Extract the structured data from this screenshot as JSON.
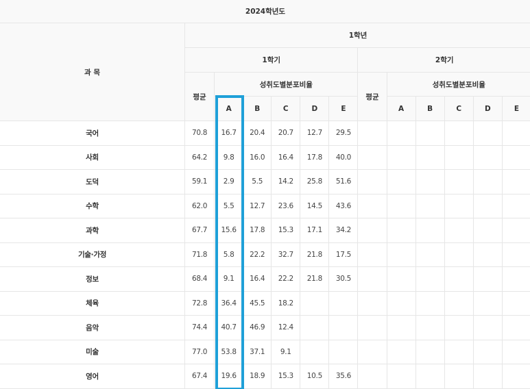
{
  "table": {
    "year": "2024학년도",
    "subject_header": "과 목",
    "grade": "1학년",
    "semesters": [
      {
        "label": "1학기",
        "avg_label": "평균",
        "dist_label": "성취도별분포비율"
      },
      {
        "label": "2학기",
        "avg_label": "평균",
        "dist_label": "성취도별분포비율"
      }
    ],
    "letters": [
      "A",
      "B",
      "C",
      "D",
      "E"
    ],
    "rows": [
      {
        "subject": "국어",
        "avg": "70.8",
        "a": "16.7",
        "b": "20.4",
        "c": "20.7",
        "d": "12.7",
        "e": "29.5"
      },
      {
        "subject": "사회",
        "avg": "64.2",
        "a": "9.8",
        "b": "16.0",
        "c": "16.4",
        "d": "17.8",
        "e": "40.0"
      },
      {
        "subject": "도덕",
        "avg": "59.1",
        "a": "2.9",
        "b": "5.5",
        "c": "14.2",
        "d": "25.8",
        "e": "51.6"
      },
      {
        "subject": "수학",
        "avg": "62.0",
        "a": "5.5",
        "b": "12.7",
        "c": "23.6",
        "d": "14.5",
        "e": "43.6"
      },
      {
        "subject": "과학",
        "avg": "67.7",
        "a": "15.6",
        "b": "17.8",
        "c": "15.3",
        "d": "17.1",
        "e": "34.2"
      },
      {
        "subject": "기술·가정",
        "avg": "71.8",
        "a": "5.8",
        "b": "22.2",
        "c": "32.7",
        "d": "21.8",
        "e": "17.5"
      },
      {
        "subject": "정보",
        "avg": "68.4",
        "a": "9.1",
        "b": "16.4",
        "c": "22.2",
        "d": "21.8",
        "e": "30.5"
      },
      {
        "subject": "체육",
        "avg": "72.8",
        "a": "36.4",
        "b": "45.5",
        "c": "18.2",
        "d": "",
        "e": ""
      },
      {
        "subject": "음악",
        "avg": "74.4",
        "a": "40.7",
        "b": "46.9",
        "c": "12.4",
        "d": "",
        "e": ""
      },
      {
        "subject": "미술",
        "avg": "77.0",
        "a": "53.8",
        "b": "37.1",
        "c": "9.1",
        "d": "",
        "e": ""
      },
      {
        "subject": "영어",
        "avg": "67.4",
        "a": "19.6",
        "b": "18.9",
        "c": "15.3",
        "d": "10.5",
        "e": "35.6"
      }
    ]
  },
  "highlight": {
    "column": "A",
    "color": "#1fa0d8"
  }
}
